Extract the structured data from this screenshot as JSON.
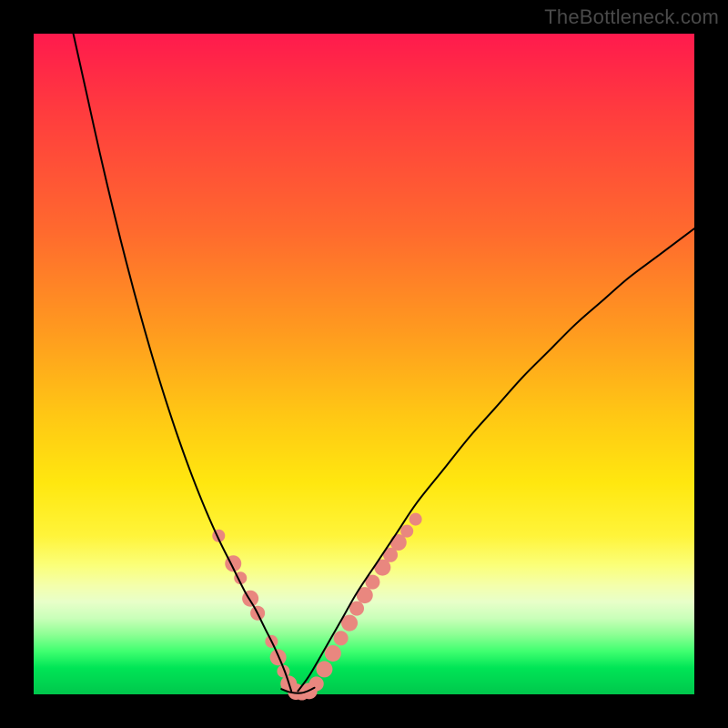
{
  "watermark": "TheBottleneck.com",
  "colors": {
    "dot": "#e9877f",
    "curve": "#000000"
  },
  "chart_data": {
    "type": "line",
    "title": "",
    "xlabel": "",
    "ylabel": "",
    "xlim": [
      0,
      100
    ],
    "ylim": [
      0,
      100
    ],
    "grid": false,
    "series": [
      {
        "name": "left-curve",
        "x": [
          6,
          8,
          10,
          12,
          14,
          16,
          18,
          20,
          22,
          24,
          26,
          28,
          30,
          32,
          33.5,
          35,
          36.5,
          38,
          39
        ],
        "y": [
          100,
          91,
          82,
          73.5,
          65.5,
          58,
          51,
          44.5,
          38.5,
          33,
          28,
          23.5,
          19.5,
          15.5,
          13,
          10,
          7,
          3.5,
          0.5
        ]
      },
      {
        "name": "right-curve",
        "x": [
          40,
          41.5,
          43,
          45,
          47,
          49,
          52,
          55,
          58,
          62,
          66,
          70,
          74,
          78,
          82,
          86,
          90,
          94,
          98,
          100
        ],
        "y": [
          0.5,
          2.5,
          5,
          8.5,
          12,
          15.5,
          20,
          24.5,
          29,
          34,
          39,
          43.5,
          48,
          52,
          56,
          59.5,
          63,
          66,
          69,
          70.5
        ]
      },
      {
        "name": "valley-floor",
        "x": [
          37.5,
          38.5,
          39.5,
          40.5,
          41.5,
          42.5
        ],
        "y": [
          0.8,
          0.4,
          0.2,
          0.2,
          0.5,
          1.0
        ]
      }
    ],
    "dots": [
      {
        "x": 28.0,
        "y": 24.0,
        "r": 7
      },
      {
        "x": 30.2,
        "y": 19.8,
        "r": 9
      },
      {
        "x": 31.3,
        "y": 17.6,
        "r": 7
      },
      {
        "x": 32.8,
        "y": 14.5,
        "r": 9
      },
      {
        "x": 33.9,
        "y": 12.3,
        "r": 8
      },
      {
        "x": 36.0,
        "y": 8.0,
        "r": 7
      },
      {
        "x": 37.0,
        "y": 5.6,
        "r": 9
      },
      {
        "x": 37.8,
        "y": 3.5,
        "r": 7
      },
      {
        "x": 38.6,
        "y": 1.6,
        "r": 9
      },
      {
        "x": 39.7,
        "y": 0.4,
        "r": 9
      },
      {
        "x": 40.6,
        "y": 0.2,
        "r": 8
      },
      {
        "x": 41.7,
        "y": 0.5,
        "r": 9
      },
      {
        "x": 42.8,
        "y": 1.6,
        "r": 8
      },
      {
        "x": 44.0,
        "y": 3.8,
        "r": 9
      },
      {
        "x": 45.3,
        "y": 6.2,
        "r": 9
      },
      {
        "x": 46.5,
        "y": 8.5,
        "r": 8
      },
      {
        "x": 47.8,
        "y": 10.8,
        "r": 9
      },
      {
        "x": 48.9,
        "y": 13.0,
        "r": 8
      },
      {
        "x": 50.1,
        "y": 15.0,
        "r": 9
      },
      {
        "x": 51.3,
        "y": 17.0,
        "r": 8
      },
      {
        "x": 52.8,
        "y": 19.2,
        "r": 9
      },
      {
        "x": 54.0,
        "y": 21.1,
        "r": 8
      },
      {
        "x": 55.2,
        "y": 23.0,
        "r": 9
      },
      {
        "x": 56.5,
        "y": 24.7,
        "r": 7
      },
      {
        "x": 57.8,
        "y": 26.5,
        "r": 7
      }
    ]
  }
}
